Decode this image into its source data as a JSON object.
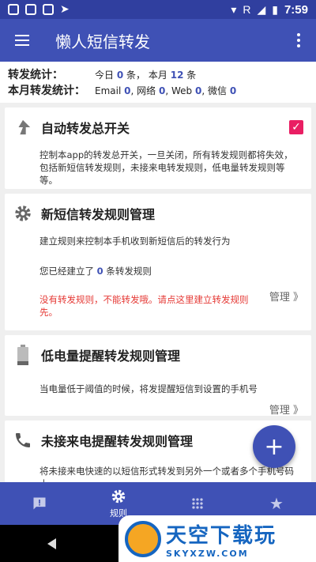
{
  "status_bar": {
    "time": "7:59",
    "carrier": "R"
  },
  "app_bar": {
    "title": "懒人短信转发"
  },
  "stats": {
    "forward_label": "转发统计：",
    "today_prefix": "今日",
    "today_count": "0",
    "today_unit": "条，",
    "month_prefix": "本月",
    "month_count": "12",
    "month_unit": "条",
    "month_label": "本月转发统计：",
    "email_label": "Email",
    "email_count": "0",
    "net_label": "网络",
    "net_count": "0",
    "web_label": "Web",
    "web_count": "0",
    "wechat_label": "微信",
    "wechat_count": "0",
    "sep": ","
  },
  "cards": {
    "master": {
      "title": "自动转发总开关",
      "description": "控制本app的转发总开关，一旦关闭，所有转发规则都将失效，包括新短信转发规则，未接来电转发规则，低电量转发规则等等。",
      "checked": true
    },
    "sms": {
      "title": "新短信转发规则管理",
      "description": "建立规则来控制本手机收到新短信后的转发行为",
      "count_prefix": "您已经建立了",
      "count": "0",
      "count_suffix": "条转发规则",
      "warning": "没有转发规则，不能转发哦。请点这里建立转发规则先。",
      "manage": "管理 》"
    },
    "battery": {
      "title": "低电量提醒转发规则管理",
      "description": "当电量低于阈值的时候，将发提醒短信到设置的手机号",
      "manage": "管理 》"
    },
    "missed": {
      "title": "未接来电提醒转发规则管理",
      "description": "将未接来电快速的以短信形式转发到另外一个或者多个手机号码上"
    }
  },
  "fab": {
    "icon": "plus-icon"
  },
  "bottom_nav": {
    "items": [
      {
        "icon": "alert-message-icon",
        "label": ""
      },
      {
        "icon": "gear-icon",
        "label": "规则"
      },
      {
        "icon": "dots-icon",
        "label": ""
      },
      {
        "icon": "star-icon",
        "label": ""
      }
    ]
  },
  "watermark": {
    "big": "天空下载玩",
    "small": "SKYXZW.COM"
  },
  "colors": {
    "primary": "#3f51b5",
    "status": "#303f9f",
    "accent": "#e91e63",
    "warning": "#e53935"
  }
}
